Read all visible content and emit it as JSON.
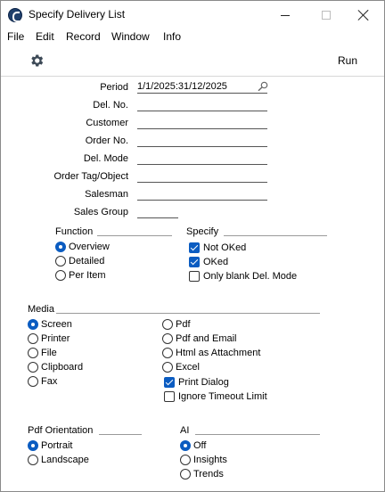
{
  "window": {
    "title": "Specify Delivery List"
  },
  "menu": [
    "File",
    "Edit",
    "Record",
    "Window",
    "Info"
  ],
  "toolbar": {
    "run_label": "Run"
  },
  "fields": {
    "period": {
      "label": "Period",
      "value": "1/1/2025:31/12/2025"
    },
    "del_no": {
      "label": "Del. No.",
      "value": ""
    },
    "customer": {
      "label": "Customer",
      "value": ""
    },
    "order_no": {
      "label": "Order No.",
      "value": ""
    },
    "del_mode": {
      "label": "Del. Mode",
      "value": ""
    },
    "order_tag": {
      "label": "Order Tag/Object",
      "value": ""
    },
    "salesman": {
      "label": "Salesman",
      "value": ""
    },
    "sales_group": {
      "label": "Sales Group",
      "value": ""
    }
  },
  "function": {
    "title": "Function",
    "options": [
      "Overview",
      "Detailed",
      "Per Item"
    ],
    "selected": "Overview"
  },
  "specify": {
    "title": "Specify",
    "options": [
      {
        "label": "Not OKed",
        "checked": true
      },
      {
        "label": "OKed",
        "checked": true
      },
      {
        "label": "Only blank Del. Mode",
        "checked": false
      }
    ]
  },
  "media": {
    "title": "Media",
    "options": [
      "Screen",
      "Printer",
      "File",
      "Clipboard",
      "Fax",
      "Pdf",
      "Pdf and Email",
      "Html as Attachment",
      "Excel"
    ],
    "selected": "Screen",
    "checks": [
      {
        "label": "Print Dialog",
        "checked": true
      },
      {
        "label": "Ignore Timeout Limit",
        "checked": false
      }
    ]
  },
  "pdf_orientation": {
    "title": "Pdf Orientation",
    "options": [
      "Portrait",
      "Landscape"
    ],
    "selected": "Portrait"
  },
  "ai": {
    "title": "AI",
    "options": [
      "Off",
      "Insights",
      "Trends"
    ],
    "selected": "Off"
  },
  "colors": {
    "accent": "#0b5cc1",
    "app_icon": "#1f3f6b"
  }
}
